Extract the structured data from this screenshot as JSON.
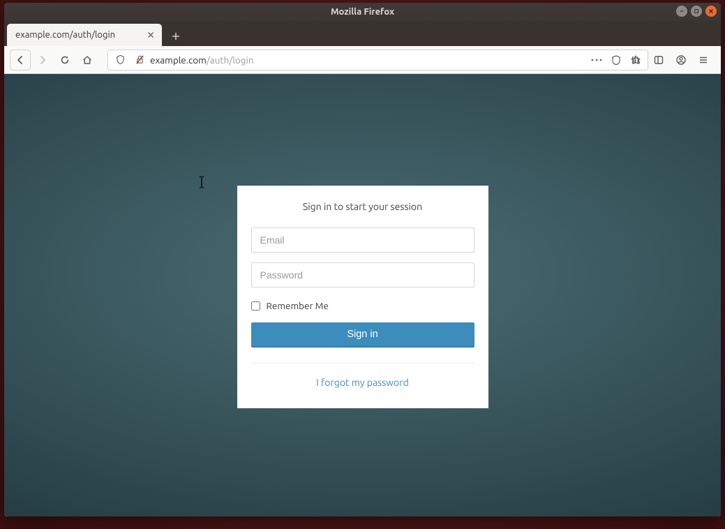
{
  "window": {
    "title": "Mozilla Firefox"
  },
  "tab": {
    "title": "example.com/auth/login"
  },
  "urlbar": {
    "domain": "example.com",
    "path": "/auth/login"
  },
  "login": {
    "message": "Sign in to start your session",
    "email_placeholder": "Email",
    "password_placeholder": "Password",
    "remember_label": "Remember Me",
    "signin_label": "Sign in",
    "forgot_label": "I forgot my password"
  }
}
